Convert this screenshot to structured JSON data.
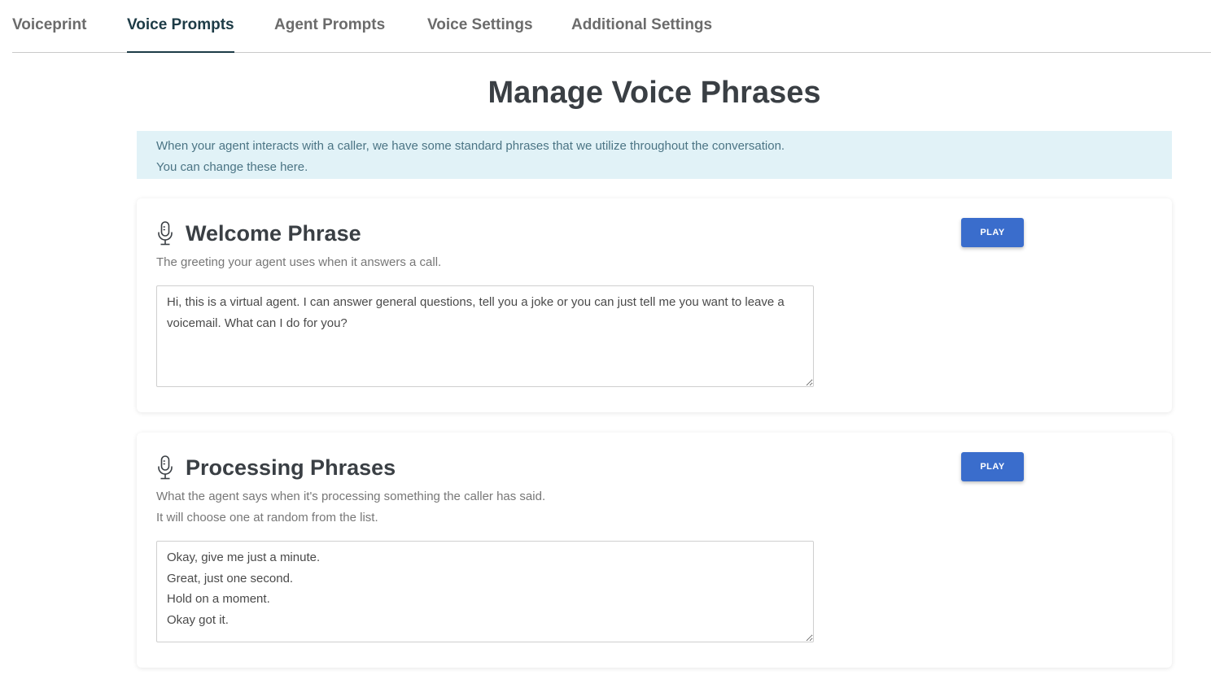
{
  "tabs": [
    {
      "label": "Voiceprint",
      "active": false
    },
    {
      "label": "Voice Prompts",
      "active": true
    },
    {
      "label": "Agent Prompts",
      "active": false
    },
    {
      "label": "Voice Settings",
      "active": false
    },
    {
      "label": "Additional Settings",
      "active": false
    }
  ],
  "page_title": "Manage Voice Phrases",
  "info_banner": {
    "line1": "When your agent interacts with a caller, we have some standard phrases that we utilize throughout the conversation.",
    "line2": "You can change these here."
  },
  "welcome": {
    "icon": "microphone-icon",
    "title": "Welcome Phrase",
    "description": "The greeting your agent uses when it answers a call.",
    "play_label": "PLAY",
    "value": "Hi, this is a virtual agent. I can answer general questions, tell you a joke or you can just tell me you want to leave a voicemail. What can I do for you?"
  },
  "processing": {
    "icon": "microphone-icon",
    "title": "Processing Phrases",
    "description_line1": "What the agent says when it's processing something the caller has said.",
    "description_line2": "It will choose one at random from the list.",
    "play_label": "PLAY",
    "value": "Okay, give me just a minute.\nGreat, just one second.\nHold on a moment.\nOkay got it."
  },
  "colors": {
    "active_tab": "#1d3b46",
    "play_button": "#3a6dcc",
    "banner_bg": "#e1f2f7",
    "banner_text": "#4b7484"
  }
}
